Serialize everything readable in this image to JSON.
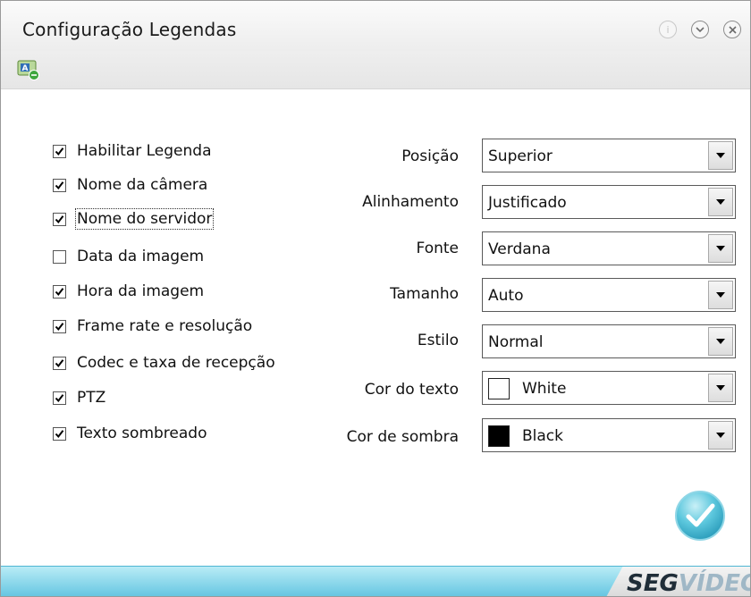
{
  "window": {
    "title": "Configuração Legendas",
    "controls": [
      "info-icon",
      "minimize-icon",
      "close-icon"
    ]
  },
  "toolbar": {
    "icon": "caption-edit-icon"
  },
  "options": [
    {
      "label": "Habilitar Legenda",
      "checked": true
    },
    {
      "label": "Nome da câmera",
      "checked": true
    },
    {
      "label": "Nome do servidor",
      "checked": true,
      "focused": true
    },
    {
      "label": "Data da imagem",
      "checked": false
    },
    {
      "label": "Hora da imagem",
      "checked": true
    },
    {
      "label": "Frame rate e resolução",
      "checked": true
    },
    {
      "label": "Codec e taxa de recepção",
      "checked": true
    },
    {
      "label": "PTZ",
      "checked": true
    },
    {
      "label": "Texto sombreado",
      "checked": true
    }
  ],
  "fields": {
    "posicao": {
      "label": "Posição",
      "value": "Superior"
    },
    "alinhamento": {
      "label": "Alinhamento",
      "value": "Justificado"
    },
    "fonte": {
      "label": "Fonte",
      "value": "Verdana"
    },
    "tamanho": {
      "label": "Tamanho",
      "value": "Auto"
    },
    "estilo": {
      "label": "Estilo",
      "value": "Normal"
    },
    "cor_texto": {
      "label": "Cor do texto",
      "value": "White",
      "swatch": "#ffffff"
    },
    "cor_sombra": {
      "label": "Cor de sombra",
      "value": "Black",
      "swatch": "#000000"
    }
  },
  "footer": {
    "brand_part1": "SEG",
    "brand_part2": "VÍDEO"
  },
  "colors": {
    "accent": "#5fc3e0",
    "confirm": "#3fb6cf"
  }
}
